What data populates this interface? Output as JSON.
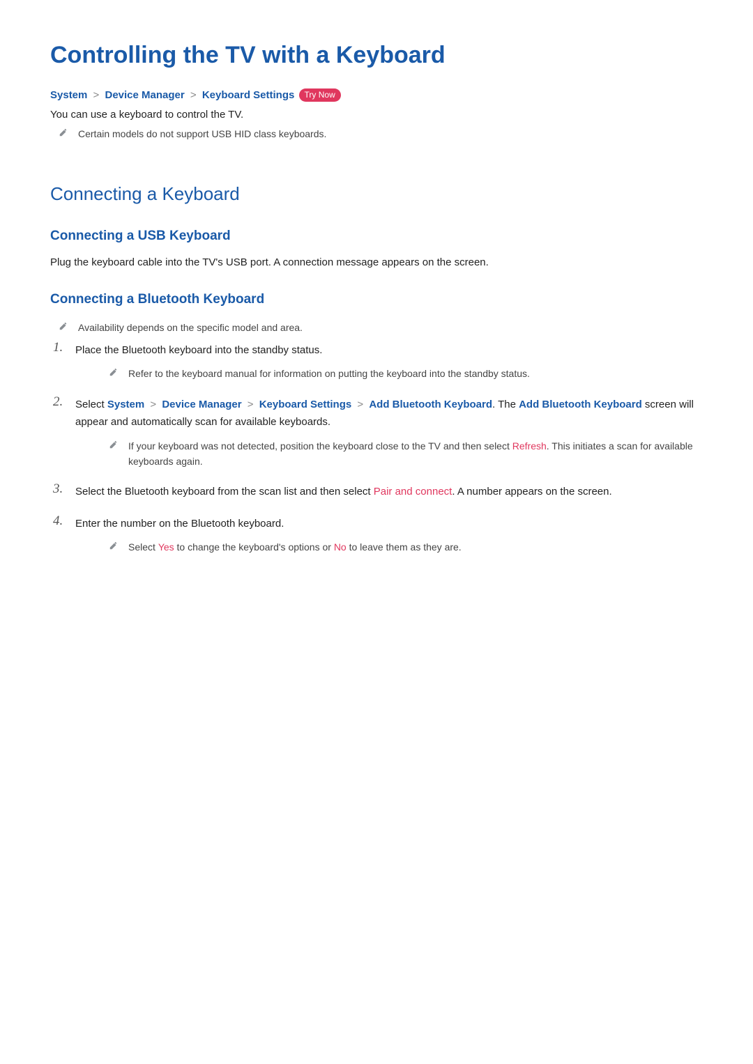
{
  "title": "Controlling the TV with a Keyboard",
  "breadcrumb": {
    "system": "System",
    "device_manager": "Device Manager",
    "keyboard_settings": "Keyboard Settings",
    "try_now": "Try Now"
  },
  "intro": "You can use a keyboard to control the TV.",
  "note_hid": "Certain models do not support USB HID class keyboards.",
  "h2_connecting": "Connecting a Keyboard",
  "h3_usb": "Connecting a USB Keyboard",
  "usb_body": "Plug the keyboard cable into the TV's USB port. A connection message appears on the screen.",
  "h3_bt": "Connecting a Bluetooth Keyboard",
  "note_bt_avail": "Availability depends on the specific model and area.",
  "step1": "Place the Bluetooth keyboard into the standby status.",
  "step1_note": "Refer to the keyboard manual for information on putting the keyboard into the standby status.",
  "step2": {
    "t1": "Select ",
    "system": "System",
    "dm": "Device Manager",
    "ks": "Keyboard Settings",
    "abk": "Add Bluetooth Keyboard",
    "t2": ". The ",
    "abk2": "Add Bluetooth Keyboard",
    "t3": " screen will appear and automatically scan for available keyboards."
  },
  "step2_note": {
    "t1": "If your keyboard was not detected, position the keyboard close to the TV and then select ",
    "refresh": "Refresh",
    "t2": ". This initiates a scan for available keyboards again."
  },
  "step3": {
    "t1": "Select the Bluetooth keyboard from the scan list and then select ",
    "pac": "Pair and connect",
    "t2": ". A number appears on the screen."
  },
  "step4": "Enter the number on the Bluetooth keyboard.",
  "step4_note": {
    "t1": "Select ",
    "yes": "Yes",
    "t2": " to change the keyboard's options or ",
    "no": "No",
    "t3": " to leave them as they are."
  }
}
